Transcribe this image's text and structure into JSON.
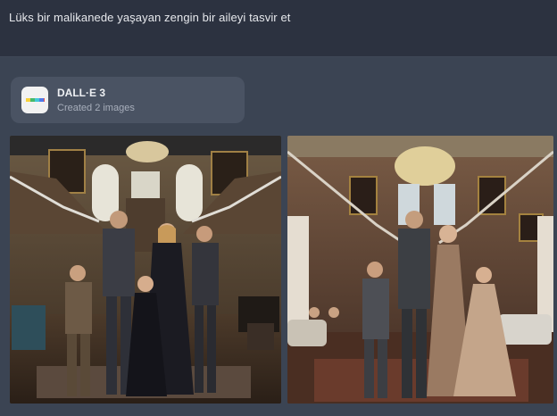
{
  "prompt": {
    "text": "Lüks bir malikanede yaşayan zengin bir aileyi tasvir et"
  },
  "tool_card": {
    "name": "DALL·E 3",
    "subtitle": "Created 2 images",
    "icon": "dalle-rainbow-icon",
    "icon_colors": [
      "#f7d23b",
      "#43c7d8",
      "#4f7bea",
      "#e84d4d",
      "#46b96b"
    ]
  },
  "images": [
    {
      "name": "generated-image-1",
      "description_icon": "image-thumbnail"
    },
    {
      "name": "generated-image-2",
      "description_icon": "image-thumbnail"
    }
  ]
}
